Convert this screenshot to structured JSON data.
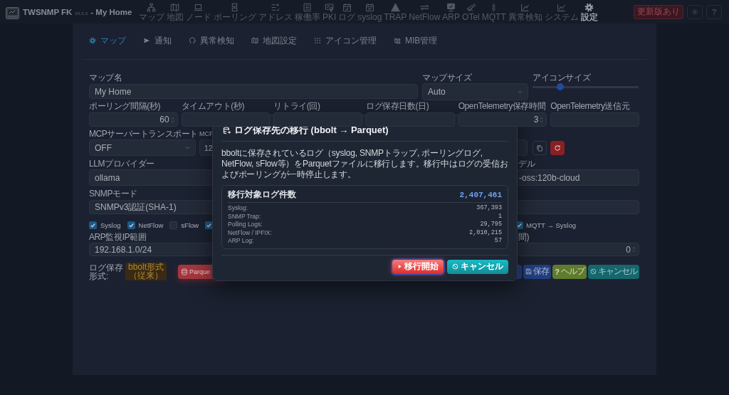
{
  "header": {
    "title": "TWSNMP FK",
    "version": "vx.x.x",
    "map_name": "- My Home"
  },
  "toolbar": [
    {
      "label": "マップ",
      "selected": false
    },
    {
      "label": "地図",
      "selected": false
    },
    {
      "label": "ノード",
      "selected": false
    },
    {
      "label": "ポーリング",
      "selected": false
    },
    {
      "label": "アドレス",
      "selected": false
    },
    {
      "label": "稼働率",
      "selected": false
    },
    {
      "label": "PKI",
      "selected": false
    },
    {
      "label": "ログ",
      "selected": false
    },
    {
      "label": "syslog",
      "selected": false
    },
    {
      "label": "TRAP",
      "selected": false
    },
    {
      "label": "NetFlow",
      "selected": false
    },
    {
      "label": "ARP",
      "selected": false
    },
    {
      "label": "OTel",
      "selected": false
    },
    {
      "label": "MQTT",
      "selected": false
    },
    {
      "label": "異常検知",
      "selected": false
    },
    {
      "label": "システム",
      "selected": false
    },
    {
      "label": "設定",
      "selected": true
    }
  ],
  "header_actions": {
    "update": "更新版あり",
    "help": "?"
  },
  "tabs": [
    {
      "label": "マップ",
      "selected": true
    },
    {
      "label": "通知",
      "selected": false
    },
    {
      "label": "異常検知",
      "selected": false
    },
    {
      "label": "地図設定",
      "selected": false
    },
    {
      "label": "アイコン管理",
      "selected": false
    },
    {
      "label": "MIB管理",
      "selected": false
    }
  ],
  "form": {
    "map_name": {
      "label": "マップ名",
      "value": "My Home"
    },
    "map_size": {
      "label": "マップサイズ",
      "value": "Auto"
    },
    "icon_size": {
      "label": "アイコンサイズ",
      "level": 0.26
    },
    "intervals": [
      {
        "label": "ポーリング間隔(秒)",
        "value": "60",
        "spinner": true
      },
      {
        "label": "タイムアウト(秒)",
        "spinner": false
      },
      {
        "label": "リトライ(回)",
        "spinner": false
      },
      {
        "label": "ログ保存日数(日)",
        "spinner": false
      },
      {
        "label": "OpenTelemetry保存時間",
        "value": "3",
        "spinner": true
      },
      {
        "label": "OpenTelemetry送信元",
        "spinner": false
      }
    ],
    "mcp_transport": {
      "label": "MCPサーバートランスポート",
      "value": "OFF"
    },
    "mcp_address": {
      "label": "MCP",
      "value": "12"
    },
    "llm_provider": {
      "label": "LLMプロバイダー",
      "value": "ollama"
    },
    "llm_model": {
      "label": "デル",
      "value": "-oss:120b-cloud"
    },
    "snmp_mode": {
      "label": "SNMPモード",
      "value": "SNMPv3認証(SHA-1)"
    },
    "log_sources": [
      {
        "label": "Syslog",
        "checked": true
      },
      {
        "label": "NetFlow",
        "checked": true
      },
      {
        "label": "sFlow",
        "checked": false
      },
      {
        "checked": true
      }
    ],
    "mqtt_syslog": {
      "label": "MQTT → Syslog",
      "checked": true
    },
    "arp_range": {
      "label": "ARP監視IP範囲",
      "value": "192.168.1.0/24"
    },
    "arp_interval": {
      "label": "間)",
      "value": "0",
      "spinner": true
    },
    "log_format": {
      "label": "ログ保存形式:",
      "badge": "bbolt形式（従来）",
      "button": "Parque"
    },
    "actions": [
      {
        "kind": "primary"
      },
      {
        "kind": "save",
        "label": "保存"
      },
      {
        "kind": "help",
        "glyph": "?",
        "label": "ヘルプ"
      },
      {
        "kind": "cancel",
        "label": "キャンセル"
      }
    ]
  },
  "dialog": {
    "title": "ログ保存先の移行 (bbolt → Parquet)",
    "message": "bboltに保存されているログ（syslog, SNMPトラップ, ポーリングログ, NetFlow, sFlow等）をParquetファイルに移行します。移行中はログの受信およびポーリングが一時停止します。",
    "summary": {
      "label": "移行対象ログ件数",
      "total": "2,407,461",
      "rows": [
        {
          "name": "Syslog:",
          "count": "367,393"
        },
        {
          "name": "SNMP Trap:",
          "count": "1"
        },
        {
          "name": "Polling Logs:",
          "count": "29,795"
        },
        {
          "name": "NetFlow / IPFIX:",
          "count": "2,010,215"
        },
        {
          "name": "ARP Log:",
          "count": "57"
        }
      ]
    },
    "buttons": [
      {
        "kind": "start",
        "label": "移行開始",
        "focused": true
      },
      {
        "kind": "cancel",
        "label": "キャンセル",
        "focused": false
      }
    ]
  }
}
